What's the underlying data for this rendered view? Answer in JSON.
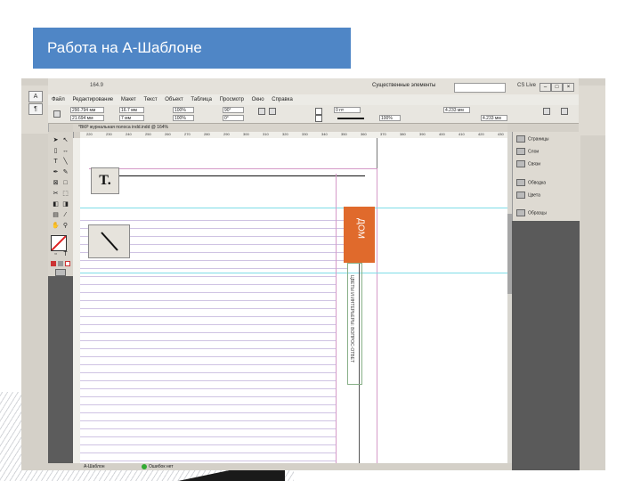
{
  "slide": {
    "title": "Работа на А-Шаблоне"
  },
  "app": {
    "zoom_top": "164.9",
    "workspace": "Существенные элементы",
    "cs_live": "CS Live",
    "menu": [
      "Файл",
      "Редактирование",
      "Макет",
      "Текст",
      "Объект",
      "Таблица",
      "Просмотр",
      "Окно",
      "Справка"
    ],
    "controls": {
      "x": "290.794 мм",
      "y": "21.694 мм",
      "w": "16.7 мм",
      "h": "7 мм",
      "scale_x": "100%",
      "scale_y": "100%",
      "angle": "90°",
      "shear": "0°",
      "stroke": "0 пт",
      "opacity": "100%",
      "w2": "4.233 мм",
      "h2": "4.233 мм"
    },
    "document_tab": "*ВКР журнальная полоса indd.indd @ 164%",
    "ruler_ticks": [
      "220",
      "230",
      "240",
      "250",
      "260",
      "270",
      "280",
      "290",
      "300",
      "310",
      "320",
      "330",
      "340",
      "350",
      "360",
      "370",
      "380",
      "390",
      "400",
      "410",
      "420",
      "430"
    ],
    "status": {
      "page": "А-Шаблон",
      "errors": "Ошибок нет"
    }
  },
  "panels": [
    {
      "label": "Страницы",
      "icon": "pages-icon"
    },
    {
      "label": "Слои",
      "icon": "layers-icon"
    },
    {
      "label": "Связи",
      "icon": "links-icon"
    },
    {
      "label": "Обводка",
      "icon": "stroke-icon"
    },
    {
      "label": "Цвета",
      "icon": "swatches-icon"
    },
    {
      "label": "Образцы",
      "icon": "samples-icon"
    }
  ],
  "page": {
    "tab_label": "ДОМ",
    "side_caption": "ЦВЕТЫ И ИНТЕРЬЕРЫ: ВОПРОС-ОТВЕТ",
    "type_tool_glyph": "T."
  },
  "colors": {
    "title_bar": "#4f86c6",
    "tab_orange": "#e06a2c",
    "guide_cyan": "#7fdce6",
    "margin_pink": "#d59ac8"
  }
}
